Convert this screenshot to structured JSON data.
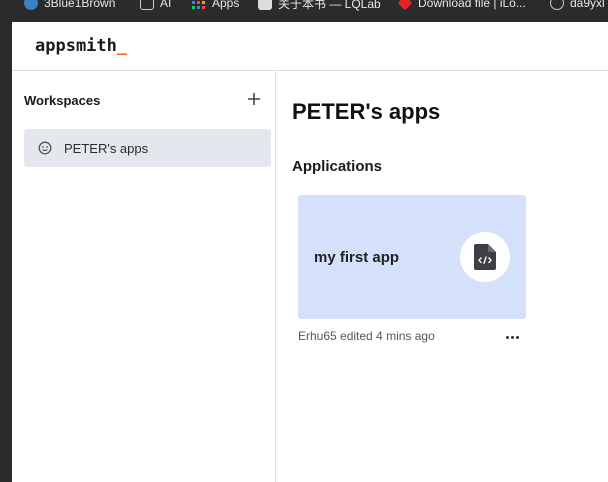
{
  "bookmarks": [
    {
      "label": "3Blue1Brown",
      "icon": "3b1b-icon",
      "color": "#3b82c4"
    },
    {
      "label": "AI",
      "icon": "folder-icon",
      "color": "#bbbbbb"
    },
    {
      "label": "Apps",
      "icon": "apps-grid-icon",
      "color": "#f59e0b"
    },
    {
      "label": "关于本书 — LQLab",
      "icon": "lqlab-icon",
      "color": "#cccccc"
    },
    {
      "label": "Download file | iLo...",
      "icon": "heart-icon",
      "color": "#e02424"
    },
    {
      "label": "da9yxl",
      "icon": "globe-icon",
      "color": "#cccccc"
    }
  ],
  "header": {
    "logo_text": "appsmith",
    "logo_cursor": "_",
    "accent": "#f86a2b"
  },
  "sidebar": {
    "title": "Workspaces",
    "add_icon": "plus-icon",
    "items": [
      {
        "label": "PETER's apps",
        "icon": "workspace-face-icon",
        "selected": true
      }
    ]
  },
  "main": {
    "title": "PETER's apps",
    "section_title": "Applications",
    "apps": [
      {
        "name": "my first app",
        "meta": "Erhu65 edited 4 mins ago",
        "icon": "code-file-icon",
        "card_color": "#d5e1fb"
      }
    ]
  }
}
